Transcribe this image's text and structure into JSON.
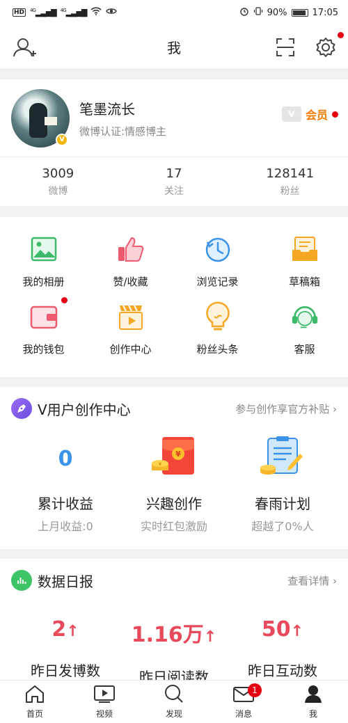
{
  "status_bar": {
    "hd": "HD",
    "signal1": "4G",
    "signal2": "4G",
    "battery": "90%",
    "time": "17:05"
  },
  "nav": {
    "title": "我"
  },
  "profile": {
    "username": "笔墨流长",
    "verification": "微博认证:情感博主",
    "vip_label": "会员",
    "vip_crown": "V",
    "avatar_badge": "V"
  },
  "stats": [
    {
      "value": "3009",
      "label": "微博"
    },
    {
      "value": "17",
      "label": "关注"
    },
    {
      "value": "128141",
      "label": "粉丝"
    }
  ],
  "grid": [
    {
      "label": "我的相册",
      "icon": "album-icon",
      "color": "#3cba6a"
    },
    {
      "label": "赞/收藏",
      "icon": "thumbs-up-icon",
      "color": "#f05a6e"
    },
    {
      "label": "浏览记录",
      "icon": "history-clock-icon",
      "color": "#3a93e8"
    },
    {
      "label": "草稿箱",
      "icon": "drafts-icon",
      "color": "#f5a623"
    },
    {
      "label": "我的钱包",
      "icon": "wallet-icon",
      "color": "#f05a6e"
    },
    {
      "label": "创作中心",
      "icon": "creation-icon",
      "color": "#f5a623"
    },
    {
      "label": "粉丝头条",
      "icon": "headline-bulb-icon",
      "color": "#f5a623"
    },
    {
      "label": "客服",
      "icon": "customer-service-icon",
      "color": "#3cba6a"
    }
  ],
  "creator": {
    "title": "V用户创作中心",
    "link": "参与创作享官方补贴",
    "items": [
      {
        "value": "0",
        "title": "累计收益",
        "sub": "上月收益:0"
      },
      {
        "title": "兴趣创作",
        "sub": "实时红包激励",
        "icon": "red-envelope-icon"
      },
      {
        "title": "春雨计划",
        "sub": "超越了0%人",
        "icon": "plan-clipboard-icon"
      }
    ]
  },
  "report": {
    "title": "数据日报",
    "link": "查看详情",
    "items": [
      {
        "value": "2",
        "label": "昨日发博数"
      },
      {
        "value": "1.16万",
        "label": "昨日阅读数"
      },
      {
        "value": "50",
        "label": "昨日互动数"
      }
    ]
  },
  "tabs": [
    {
      "label": "首页",
      "icon": "home-icon"
    },
    {
      "label": "视频",
      "icon": "video-icon"
    },
    {
      "label": "发现",
      "icon": "search-icon"
    },
    {
      "label": "消息",
      "icon": "message-icon",
      "badge": "1"
    },
    {
      "label": "我",
      "icon": "profile-icon"
    }
  ],
  "colors": {
    "accent_red": "#e60012",
    "report_red": "#e8495b",
    "vip_orange": "#f47b00"
  }
}
